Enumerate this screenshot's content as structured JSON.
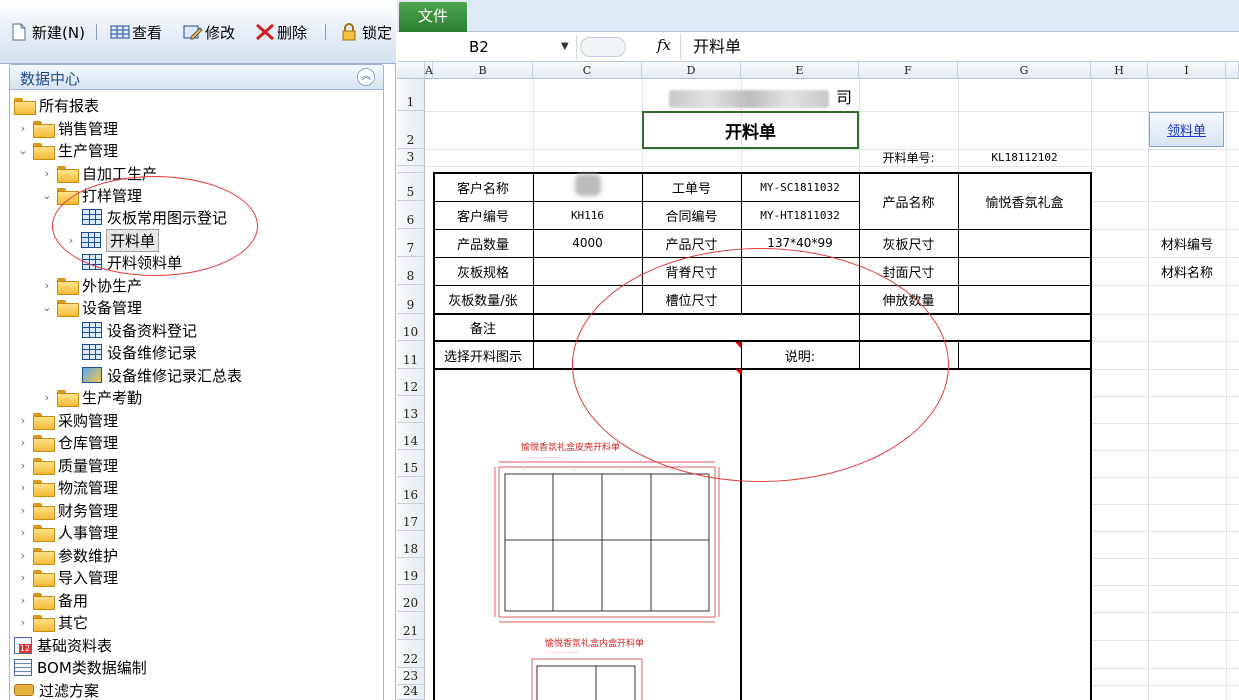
{
  "toolbar": {
    "new_label": "新建(N)",
    "view_label": "查看",
    "edit_label": "修改",
    "delete_label": "删除",
    "lock_label": "锁定"
  },
  "panel": {
    "title": "数据中心",
    "collapse_icon": "double-chevron-up-icon"
  },
  "tree": {
    "root": "所有报表",
    "sales": "销售管理",
    "production": "生产管理",
    "self_production": "自加工生产",
    "sampling": "打样管理",
    "sampling_chart": "灰板常用图示登记",
    "cutting_sheet": "开料单",
    "cutting_material": "开料领料单",
    "outsourcing": "外协生产",
    "equipment": "设备管理",
    "equip_register": "设备资料登记",
    "equip_repair": "设备维修记录",
    "equip_repair_sum": "设备维修记录汇总表",
    "attendance": "生产考勤",
    "purchase": "采购管理",
    "warehouse": "仓库管理",
    "quality": "质量管理",
    "logistics": "物流管理",
    "finance": "财务管理",
    "hr": "人事管理",
    "params": "参数维护",
    "import": "导入管理",
    "spare": "备用",
    "other": "其它",
    "basic_report": "基础资料表",
    "bom": "BOM类数据编制",
    "filter": "过滤方案"
  },
  "ribbon": {
    "file_tab": "文件"
  },
  "formula_bar": {
    "name_box": "B2",
    "fx": "fx",
    "formula": "开料单"
  },
  "sheet": {
    "columns": [
      "A",
      "B",
      "C",
      "D",
      "E",
      "F",
      "G",
      "H",
      "I"
    ],
    "rows": [
      "1",
      "2",
      "3",
      "4",
      "5",
      "6",
      "7",
      "8",
      "9",
      "10",
      "11",
      "12",
      "13",
      "14",
      "15",
      "16",
      "17",
      "18",
      "19",
      "20",
      "21",
      "22",
      "23",
      "24"
    ],
    "company_suffix": "司",
    "title": "开料单",
    "order_no_label": "开料单号:",
    "order_no": "KL18112102",
    "link_button": "领料单",
    "customer_name_label": "客户名称",
    "work_order_label": "工单号",
    "work_order": "MY-SC1811032",
    "product_name_label": "产品名称",
    "product_name": "愉悦香氛礼盒",
    "customer_no_label": "客户编号",
    "customer_no": "KH116",
    "contract_no_label": "合同编号",
    "contract_no": "MY-HT1811032",
    "qty_label": "产品数量",
    "qty": "4000",
    "size_label": "产品尺寸",
    "size": "137*40*99",
    "board_size_label": "灰板尺寸",
    "material_code_label": "材料编号",
    "board_spec_label": "灰板规格",
    "spine_size_label": "背脊尺寸",
    "cover_size_label": "封面尺寸",
    "material_name_label": "材料名称",
    "board_count_label": "灰板数量/张",
    "slot_size_label": "槽位尺寸",
    "stretch_count_label": "伸放数量",
    "remark_label": "备注",
    "choose_chart_label": "选择开料图示",
    "note_label": "说明:",
    "drawing1_title": "愉悦香氛礼盒皮壳开料单",
    "drawing2_title": "愉悦香氛礼盒内盒开料单"
  }
}
